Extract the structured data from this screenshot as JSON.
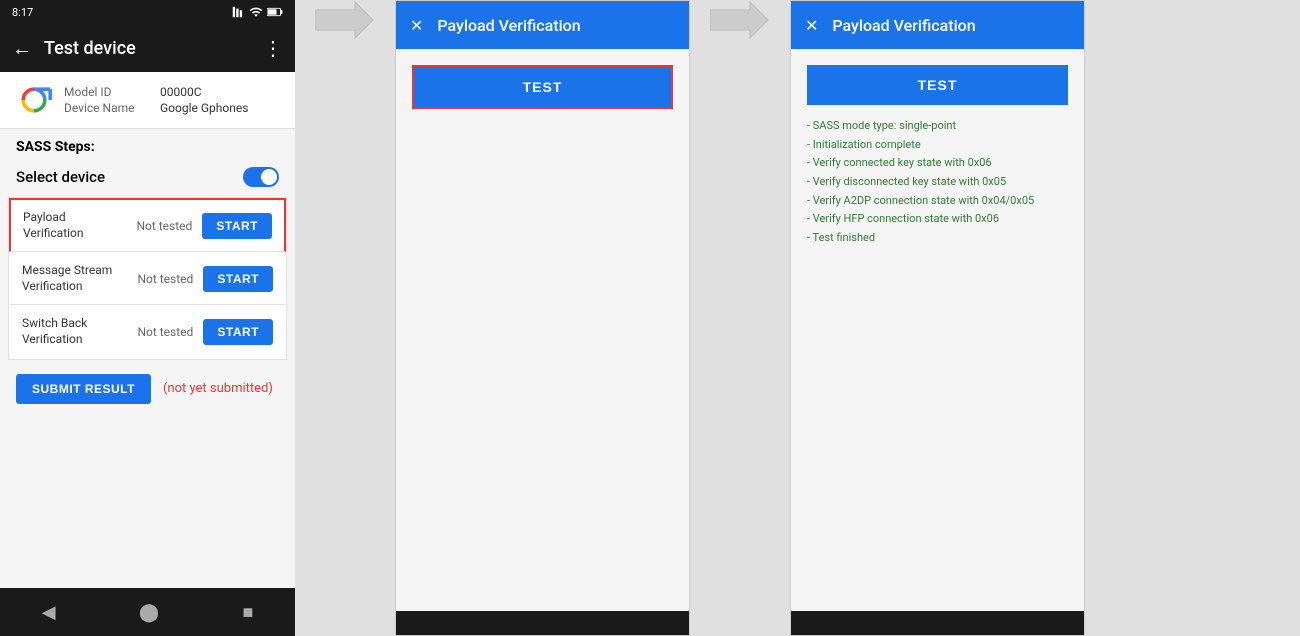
{
  "phone": {
    "status_time": "8:17",
    "status_icons": "🔋",
    "app_bar_title": "Test device",
    "device_model_label": "Model ID",
    "device_model_value": "00000C",
    "device_name_label": "Device Name",
    "device_name_value": "Google Gphones",
    "sass_steps_label": "SASS Steps:",
    "select_device_label": "Select device",
    "steps": [
      {
        "name": "Payload Verification",
        "status": "Not tested",
        "btn": "START"
      },
      {
        "name": "Message Stream Verification",
        "status": "Not tested",
        "btn": "START"
      },
      {
        "name": "Switch Back Verification",
        "status": "Not tested",
        "btn": "START"
      }
    ],
    "submit_btn_label": "SUBMIT RESULT",
    "not_submitted_text": "(not yet submitted)"
  },
  "dialog1": {
    "title": "Payload Verification",
    "close_icon": "✕",
    "test_btn_label": "TEST"
  },
  "dialog2": {
    "title": "Payload Verification",
    "close_icon": "✕",
    "test_btn_label": "TEST",
    "results": [
      "- SASS mode type: single-point",
      "- Initialization complete",
      "- Verify connected key state with 0x06",
      "- Verify disconnected key state with 0x05",
      "- Verify A2DP connection state with 0x04/0x05",
      "- Verify HFP connection state with 0x06",
      "- Test finished"
    ]
  },
  "arrows": {
    "arrow1_label": "arrow-right-1",
    "arrow2_label": "arrow-right-2"
  }
}
